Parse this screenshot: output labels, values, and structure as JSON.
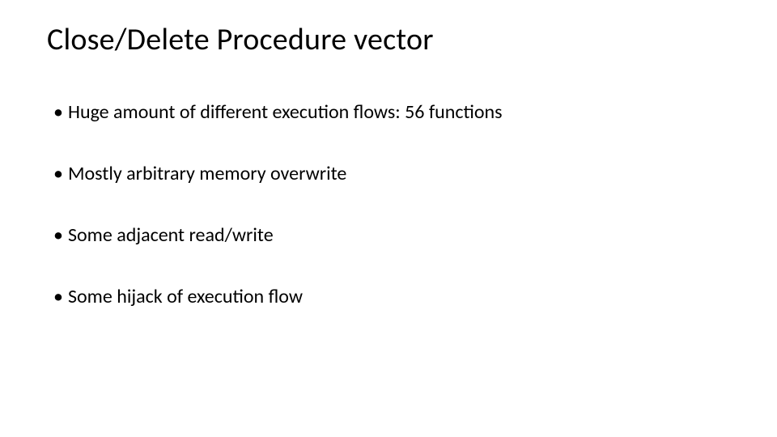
{
  "slide": {
    "title": "Close/Delete Procedure vector",
    "bullets": [
      "Huge amount of different execution flows: 56 functions",
      "Mostly arbitrary memory overwrite",
      "Some adjacent read/write",
      "Some hijack of execution flow"
    ]
  }
}
